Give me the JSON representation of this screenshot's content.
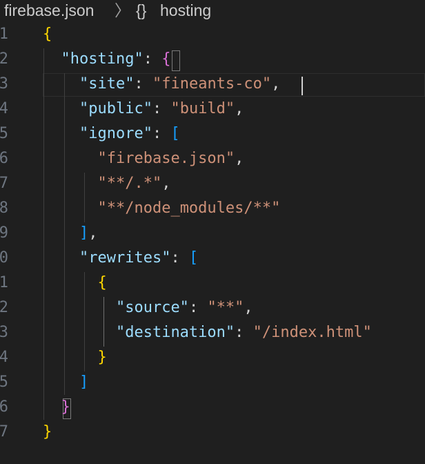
{
  "breadcrumb": {
    "file": "firebase.json",
    "separator": "〉",
    "symbol_icon": "{}",
    "symbol": "hosting"
  },
  "editor": {
    "lines": [
      {
        "num": "1",
        "tokens": [
          {
            "t": "{",
            "c": "b1"
          }
        ]
      },
      {
        "num": "2",
        "tokens": [
          {
            "t": "  "
          },
          {
            "t": "\"hosting\"",
            "c": "key"
          },
          {
            "t": ": ",
            "c": "punc"
          },
          {
            "t": "{",
            "c": "b2"
          }
        ]
      },
      {
        "num": "3",
        "tokens": [
          {
            "t": "    "
          },
          {
            "t": "\"site\"",
            "c": "key"
          },
          {
            "t": ": ",
            "c": "punc"
          },
          {
            "t": "\"fineants-co\"",
            "c": "str"
          },
          {
            "t": ",",
            "c": "punc"
          }
        ]
      },
      {
        "num": "4",
        "tokens": [
          {
            "t": "    "
          },
          {
            "t": "\"public\"",
            "c": "key"
          },
          {
            "t": ": ",
            "c": "punc"
          },
          {
            "t": "\"build\"",
            "c": "str"
          },
          {
            "t": ",",
            "c": "punc"
          }
        ]
      },
      {
        "num": "5",
        "tokens": [
          {
            "t": "    "
          },
          {
            "t": "\"ignore\"",
            "c": "key"
          },
          {
            "t": ": ",
            "c": "punc"
          },
          {
            "t": "[",
            "c": "b3"
          }
        ]
      },
      {
        "num": "6",
        "tokens": [
          {
            "t": "      "
          },
          {
            "t": "\"firebase.json\"",
            "c": "str"
          },
          {
            "t": ",",
            "c": "punc"
          }
        ]
      },
      {
        "num": "7",
        "tokens": [
          {
            "t": "      "
          },
          {
            "t": "\"**/.*\"",
            "c": "str"
          },
          {
            "t": ",",
            "c": "punc"
          }
        ]
      },
      {
        "num": "8",
        "tokens": [
          {
            "t": "      "
          },
          {
            "t": "\"**/node_modules/**\"",
            "c": "str"
          }
        ]
      },
      {
        "num": "9",
        "tokens": [
          {
            "t": "    "
          },
          {
            "t": "]",
            "c": "b3"
          },
          {
            "t": ",",
            "c": "punc"
          }
        ]
      },
      {
        "num": "0",
        "tokens": [
          {
            "t": "    "
          },
          {
            "t": "\"rewrites\"",
            "c": "key"
          },
          {
            "t": ": ",
            "c": "punc"
          },
          {
            "t": "[",
            "c": "b3"
          }
        ]
      },
      {
        "num": "1",
        "tokens": [
          {
            "t": "      "
          },
          {
            "t": "{",
            "c": "b1"
          }
        ]
      },
      {
        "num": "2",
        "tokens": [
          {
            "t": "        "
          },
          {
            "t": "\"source\"",
            "c": "key"
          },
          {
            "t": ": ",
            "c": "punc"
          },
          {
            "t": "\"**\"",
            "c": "str"
          },
          {
            "t": ",",
            "c": "punc"
          }
        ]
      },
      {
        "num": "3",
        "tokens": [
          {
            "t": "        "
          },
          {
            "t": "\"destination\"",
            "c": "key"
          },
          {
            "t": ": ",
            "c": "punc"
          },
          {
            "t": "\"/index.html\"",
            "c": "str"
          }
        ]
      },
      {
        "num": "4",
        "tokens": [
          {
            "t": "      "
          },
          {
            "t": "}",
            "c": "b1"
          }
        ]
      },
      {
        "num": "5",
        "tokens": [
          {
            "t": "    "
          },
          {
            "t": "]",
            "c": "b3"
          }
        ]
      },
      {
        "num": "6",
        "tokens": [
          {
            "t": "  "
          },
          {
            "t": "}",
            "c": "b2"
          }
        ]
      },
      {
        "num": "7",
        "tokens": [
          {
            "t": "}",
            "c": "b1"
          }
        ]
      }
    ]
  }
}
